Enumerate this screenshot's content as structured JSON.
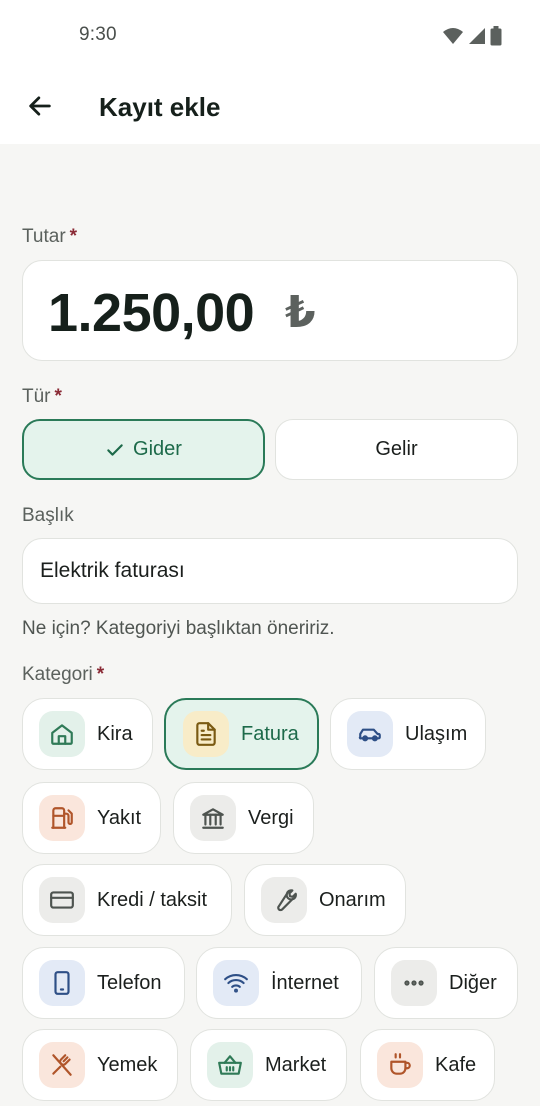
{
  "status": {
    "time": "9:30"
  },
  "header": {
    "title": "Kayıt ekle"
  },
  "amount": {
    "label": "Tutar",
    "value": "1.250,00",
    "currency": "₺"
  },
  "type": {
    "label": "Tür",
    "expense_label": "Gider",
    "income_label": "Gelir",
    "selected": "expense"
  },
  "title_field": {
    "label": "Başlık",
    "value": "Elektrik faturası",
    "hint": "Ne için? Kategoriyi başlıktan öneririz."
  },
  "category": {
    "label": "Kategori",
    "required_mark": "*",
    "selected": "Fatura",
    "items": [
      {
        "label": "Kira",
        "icon": "home-icon",
        "color": "#2f7a57",
        "bg": "#e3f1ea"
      },
      {
        "label": "Fatura",
        "icon": "document-icon",
        "color": "#7a5a12",
        "bg": "#f8ecc8"
      },
      {
        "label": "Ulaşım",
        "icon": "car-icon",
        "color": "#2e4f86",
        "bg": "#e3eaf6"
      },
      {
        "label": "Yakıt",
        "icon": "fuel-icon",
        "color": "#b0552a",
        "bg": "#fae6dc"
      },
      {
        "label": "Vergi",
        "icon": "bank-icon",
        "color": "#4e5450",
        "bg": "#ececea"
      },
      {
        "label": "Kredi / taksit",
        "icon": "credit-card-icon",
        "color": "#4e5450",
        "bg": "#ececea"
      },
      {
        "label": "Onarım",
        "icon": "wrench-icon",
        "color": "#4e5450",
        "bg": "#ececea"
      },
      {
        "label": "Telefon",
        "icon": "phone-icon",
        "color": "#2e4f86",
        "bg": "#e3eaf6"
      },
      {
        "label": "İnternet",
        "icon": "wifi-icon",
        "color": "#2e4f86",
        "bg": "#e3eaf6"
      },
      {
        "label": "Diğer",
        "icon": "more-icon",
        "color": "#4e5450",
        "bg": "#ececea"
      },
      {
        "label": "Yemek",
        "icon": "utensils-icon",
        "color": "#b0552a",
        "bg": "#fae6dc"
      },
      {
        "label": "Market",
        "icon": "basket-icon",
        "color": "#2f7a57",
        "bg": "#e3f1ea"
      },
      {
        "label": "Kafe",
        "icon": "coffee-icon",
        "color": "#b0552a",
        "bg": "#fae6dc"
      }
    ]
  },
  "colors": {
    "accent": "#2a7a58",
    "accent_bg": "#e4f3ec",
    "required": "#8a2a35"
  }
}
